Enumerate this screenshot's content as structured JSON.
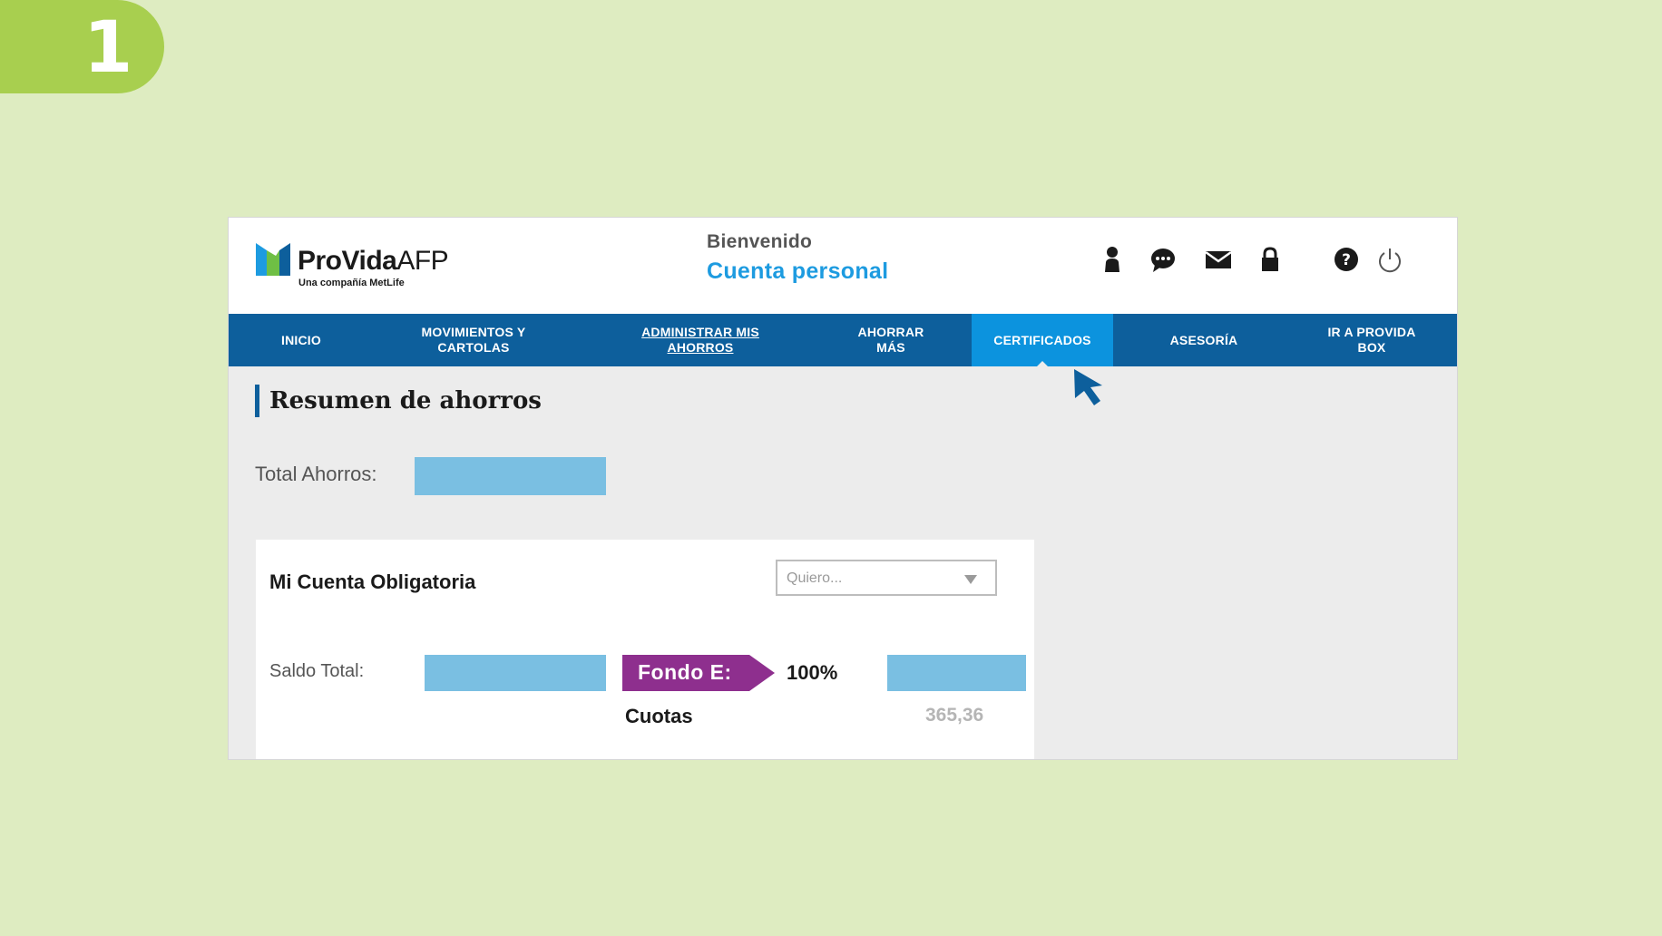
{
  "step": {
    "number": "1"
  },
  "header": {
    "logo": {
      "brand": "ProVida",
      "suffix": "AFP",
      "tagline": "Una compañía MetLife"
    },
    "welcome_label": "Bienvenido",
    "account_label": "Cuenta personal",
    "icons": [
      "user-icon",
      "chat-icon",
      "mail-icon",
      "lock-icon",
      "help-icon",
      "power-icon"
    ]
  },
  "nav": {
    "items": [
      {
        "label": "INICIO"
      },
      {
        "label": "MOVIMIENTOS Y\nCARTOLAS"
      },
      {
        "label": "ADMINISTRAR MIS\nAHORROS"
      },
      {
        "label": "AHORRAR\nMÁS"
      },
      {
        "label": "CERTIFICADOS",
        "active": true
      },
      {
        "label": "ASESORÍA"
      },
      {
        "label": "IR A PROVIDA\nBOX"
      }
    ]
  },
  "main": {
    "section_title": "Resumen de ahorros",
    "total_label": "Total Ahorros:",
    "card": {
      "title": "Mi Cuenta Obligatoria",
      "dropdown_placeholder": "Quiero...",
      "saldo_label": "Saldo Total:",
      "fund_label": "Fondo E:",
      "fund_percent": "100%",
      "cuotas_label": "Cuotas",
      "cuotas_value": "365,36"
    }
  },
  "colors": {
    "background": "#deecc1",
    "badge": "#a8cf4f",
    "nav": "#0d5f9c",
    "nav_active": "#0c93de",
    "accent_blue": "#1d9be0",
    "redacted_bar": "#7abfe2",
    "fund_tag": "#8e2f8e"
  }
}
